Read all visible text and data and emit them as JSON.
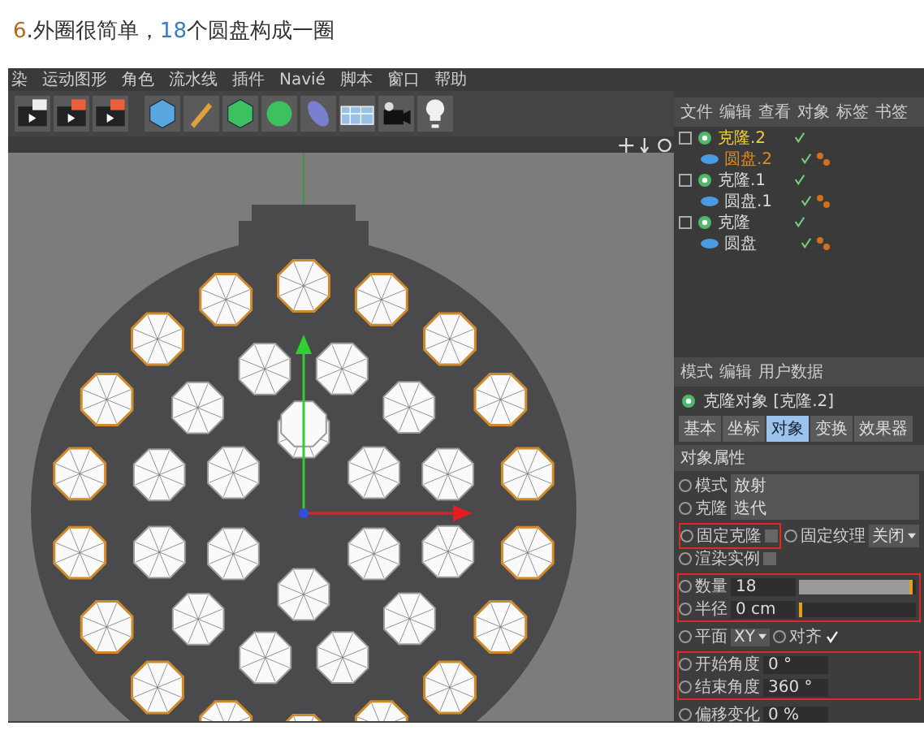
{
  "caption": {
    "parts": [
      {
        "text": "6",
        "color": "#b5651d"
      },
      {
        "text": ".外圈很简单，",
        "color": "#333333"
      },
      {
        "text": "18",
        "color": "#3a7cc0"
      },
      {
        "text": "个圆盘构成一圈",
        "color": "#333333"
      }
    ]
  },
  "menu": [
    "染",
    "运动图形",
    "角色",
    "流水线",
    "插件",
    "Navié",
    "脚本",
    "窗口",
    "帮助"
  ],
  "object_manager": {
    "menu": [
      "文件",
      "编辑",
      "查看",
      "对象",
      "标签",
      "书签"
    ],
    "tree": [
      {
        "name": "克隆.2",
        "selected": true,
        "children": [
          {
            "name": "圆盘.2",
            "selected": true
          }
        ]
      },
      {
        "name": "克隆.1",
        "selected": false,
        "children": [
          {
            "name": "圆盘.1",
            "selected": false
          }
        ]
      },
      {
        "name": "克隆",
        "selected": false,
        "children": [
          {
            "name": "圆盘",
            "selected": false
          }
        ]
      }
    ]
  },
  "attributes": {
    "menu": [
      "模式",
      "编辑",
      "用户数据"
    ],
    "title": "克隆对象 [克隆.2]",
    "tabs": [
      {
        "label": "基本",
        "selected": false
      },
      {
        "label": "坐标",
        "selected": false
      },
      {
        "label": "对象",
        "selected": true
      },
      {
        "label": "变换",
        "selected": false
      },
      {
        "label": "效果器",
        "selected": false
      }
    ],
    "section": "对象属性",
    "groups": [
      {
        "highlighted": false,
        "rows": [
          {
            "kind": "dropdown",
            "label": "模式",
            "value": "放射"
          },
          {
            "kind": "dropdown",
            "label": "克隆",
            "value": "迭代"
          }
        ]
      },
      {
        "highlighted": false,
        "rows": [
          {
            "kind": "pair",
            "label": "固定克隆",
            "checked": false,
            "highlighted": true,
            "label_2": "固定纹理",
            "value": "关闭"
          },
          {
            "kind": "checkbox",
            "label": "渲染实例",
            "checked": false
          }
        ]
      },
      {
        "highlighted": true,
        "rows": [
          {
            "kind": "slider",
            "label": "数量",
            "value": "18",
            "level": 0.97
          },
          {
            "kind": "slider",
            "label": "半径",
            "value": "0 cm",
            "level": 0.0
          }
        ]
      },
      {
        "highlighted": false,
        "rows": [
          {
            "kind": "plane",
            "label": "平面",
            "value": "XY",
            "label_2": "对齐",
            "checked": true
          }
        ]
      },
      {
        "highlighted": true,
        "rows": [
          {
            "kind": "number",
            "label": "开始角度",
            "value": "0 °"
          },
          {
            "kind": "number",
            "label": "结束角度",
            "value": "360 °"
          }
        ]
      },
      {
        "highlighted": false,
        "rows": [
          {
            "kind": "number",
            "label": "偏移变化",
            "value": "0 %"
          }
        ]
      }
    ]
  }
}
